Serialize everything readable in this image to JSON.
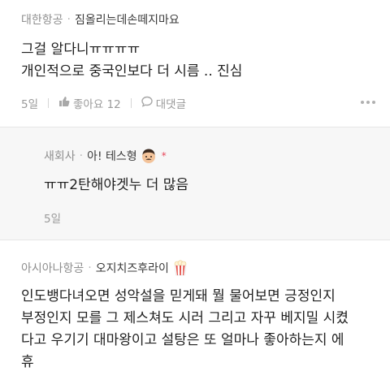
{
  "comment1": {
    "affiliation": "대한항공",
    "separator": "·",
    "nickname": "짐올리는데손떼지마요",
    "lines": [
      "그걸 알다니ㅠㅠㅠㅠ",
      "개인적으로 중국인보다 더 시름 .. 진심"
    ],
    "time": "5일",
    "like_label": "좋아요 12",
    "reply_label": "대댓글"
  },
  "reply1": {
    "affiliation": "새회사",
    "separator": "·",
    "nickname": "아! 테스형",
    "author_mark": "*",
    "lines": [
      "ㅠㅠ2탄해야겟누 더 많음"
    ],
    "time": "5일"
  },
  "comment3": {
    "affiliation": "아시아나항공",
    "separator": "·",
    "nickname": "오지치즈후라이",
    "lines": [
      "인도뱅다녀오면 성악설을 믿게돼  뭘 물어보면 긍정인지",
      "부정인지 모를 그 제스쳐도 시러 그리고 자꾸 베지밀 시켰",
      "다고 우기기 대마왕이고 설탕은 또 얼마나 좋아하는지  에",
      "휴"
    ]
  },
  "colors": {
    "accent_star": "#e8475b",
    "reply_bg": "#f7f7f7"
  },
  "icons": [
    "thumb-icon",
    "chat-bubble-icon",
    "more-dots-icon",
    "man-face-icon",
    "popcorn-icon"
  ]
}
